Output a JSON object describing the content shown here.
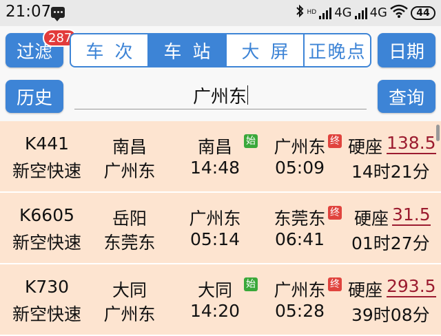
{
  "status_bar": {
    "time": "21:07",
    "network1": "4G",
    "network2": "4G",
    "hd_label": "HD",
    "battery": "44"
  },
  "toolbar": {
    "filter_label": "过滤",
    "filter_badge": "287",
    "tabs": [
      {
        "label": "车次",
        "active": false
      },
      {
        "label": "车站",
        "active": true
      },
      {
        "label": "大屏",
        "active": false
      },
      {
        "label": "正晚点",
        "active": false
      }
    ],
    "date_label": "日期",
    "history_label": "历史",
    "query_label": "查询"
  },
  "search": {
    "value": "广州东"
  },
  "trains": [
    {
      "number": "K441",
      "type": "新空快速",
      "origin": "南昌",
      "destination": "广州东",
      "station_from": "南昌",
      "depart": "14:48",
      "station_to": "广州东",
      "arrive": "05:09",
      "seat": "硬座",
      "price": "138.5",
      "duration": "14时21分",
      "start_tag": "始",
      "end_tag": "终"
    },
    {
      "number": "K6605",
      "type": "新空快速",
      "origin": "岳阳",
      "destination": "东莞东",
      "station_from": "广州东",
      "depart": "05:14",
      "station_to": "东莞东",
      "arrive": "06:41",
      "seat": "硬座",
      "price": "31.5",
      "duration": "01时27分",
      "start_tag": "",
      "end_tag": "终"
    },
    {
      "number": "K730",
      "type": "新空快速",
      "origin": "大同",
      "destination": "广州东",
      "station_from": "大同",
      "depart": "14:20",
      "station_to": "广州东",
      "arrive": "05:28",
      "seat": "硬座",
      "price": "293.5",
      "duration": "39时08分",
      "start_tag": "始",
      "end_tag": "终"
    }
  ],
  "colors": {
    "accent": "#3d84d6",
    "row_bg": "#fde4d0",
    "price": "#9b1b2f",
    "start_tag": "#3aa83a",
    "end_tag": "#e0443e"
  }
}
